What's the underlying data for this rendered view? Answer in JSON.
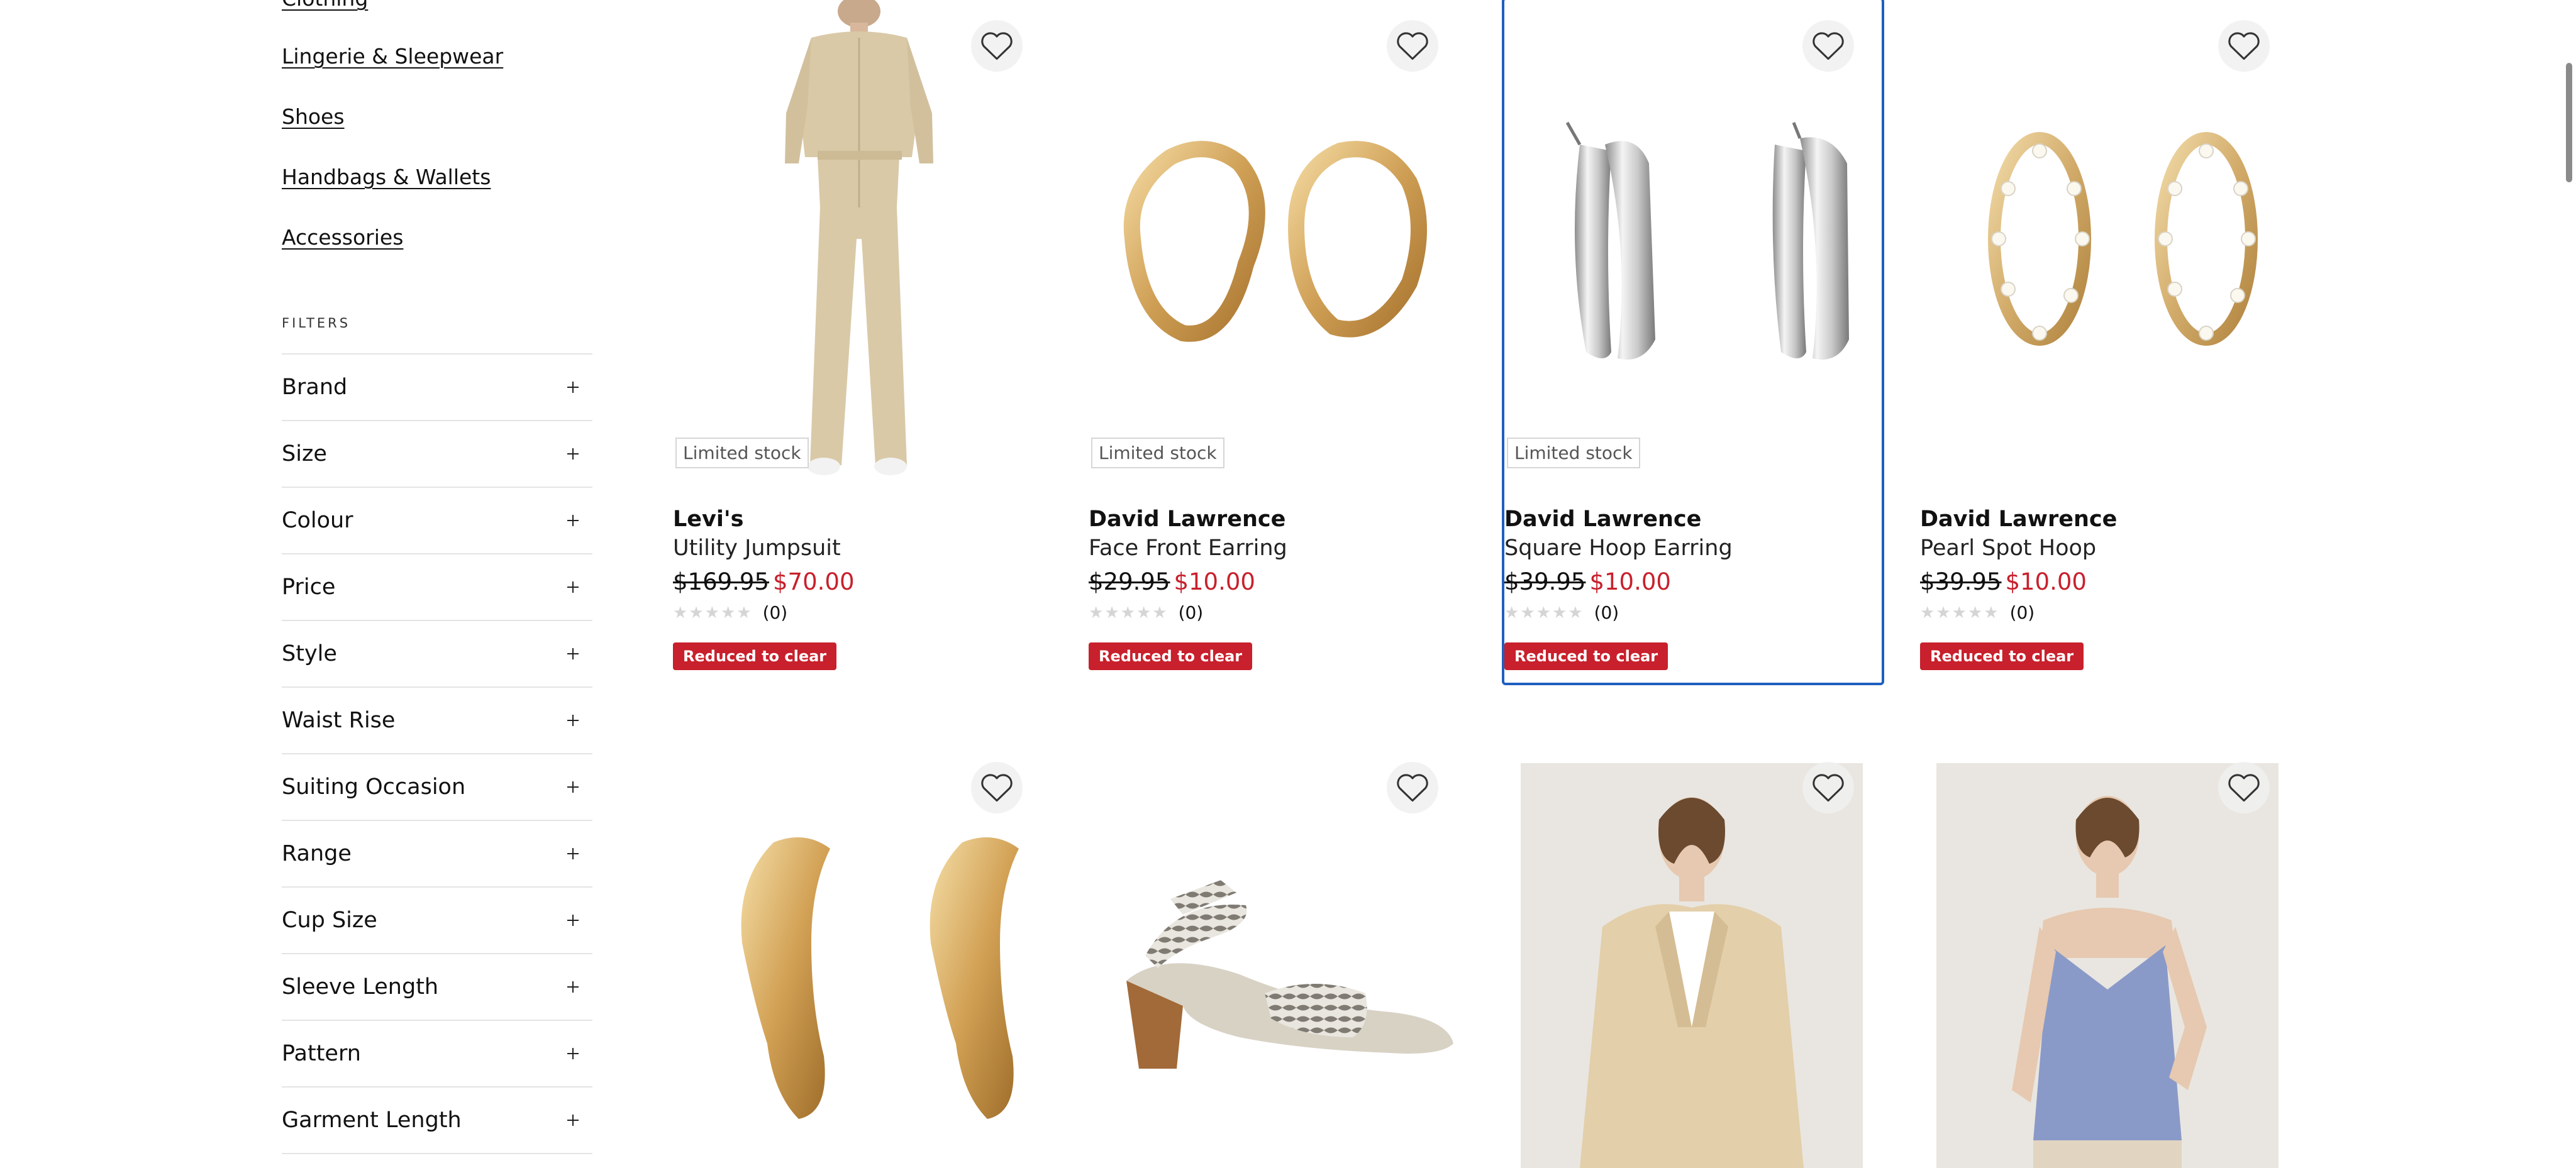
{
  "categories": [
    {
      "label": "Clothing"
    },
    {
      "label": "Lingerie & Sleepwear"
    },
    {
      "label": "Shoes"
    },
    {
      "label": "Handbags & Wallets"
    },
    {
      "label": "Accessories"
    }
  ],
  "filters": {
    "heading": "FILTERS",
    "items": [
      {
        "label": "Brand"
      },
      {
        "label": "Size"
      },
      {
        "label": "Colour"
      },
      {
        "label": "Price"
      },
      {
        "label": "Style"
      },
      {
        "label": "Waist Rise"
      },
      {
        "label": "Suiting Occasion"
      },
      {
        "label": "Range"
      },
      {
        "label": "Cup Size"
      },
      {
        "label": "Sleeve Length"
      },
      {
        "label": "Pattern"
      },
      {
        "label": "Garment Length"
      }
    ]
  },
  "products": [
    {
      "brand": "Levi's",
      "name": "Utility Jumpsuit",
      "old_price": "$169.95",
      "new_price": "$70.00",
      "badge": "Limited stock",
      "rating_count": "(0)",
      "promo": "Reduced to clear",
      "image_icon": "jumpsuit-image"
    },
    {
      "brand": "David Lawrence",
      "name": "Face Front Earring",
      "old_price": "$29.95",
      "new_price": "$10.00",
      "badge": "Limited stock",
      "rating_count": "(0)",
      "promo": "Reduced to clear",
      "image_icon": "gold-earrings-image"
    },
    {
      "brand": "David Lawrence",
      "name": "Square Hoop Earring",
      "old_price": "$39.95",
      "new_price": "$10.00",
      "badge": "Limited stock",
      "rating_count": "(0)",
      "promo": "Reduced to clear",
      "image_icon": "silver-hoop-image"
    },
    {
      "brand": "David Lawrence",
      "name": "Pearl Spot Hoop",
      "old_price": "$39.95",
      "new_price": "$10.00",
      "badge": "",
      "rating_count": "(0)",
      "promo": "Reduced to clear",
      "image_icon": "pearl-hoop-image"
    }
  ],
  "row2_images": [
    "gold-sculpted-earrings-image",
    "snakeskin-sandal-image",
    "beige-blazer-model-image",
    "blue-cami-model-image"
  ],
  "colors": {
    "sale": "#c8202c",
    "selected_outline": "#1f5fbf"
  }
}
